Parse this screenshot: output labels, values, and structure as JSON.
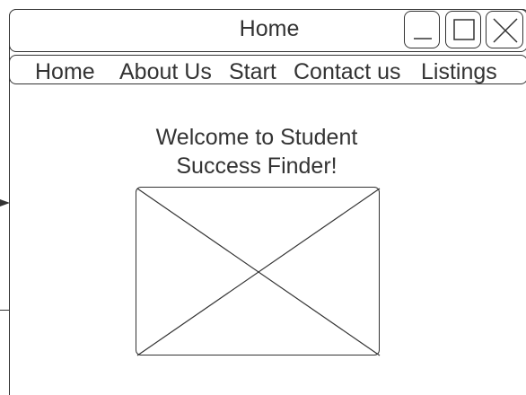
{
  "window": {
    "title": "Home"
  },
  "nav": {
    "items": [
      {
        "label": "Home"
      },
      {
        "label": "About Us"
      },
      {
        "label": "Start"
      },
      {
        "label": "Contact us"
      },
      {
        "label": "Listings"
      }
    ]
  },
  "main": {
    "welcome_line1": "Welcome to Student",
    "welcome_line2": "Success Finder!"
  },
  "icons": {
    "minimize": "minimize-icon",
    "maximize": "maximize-icon",
    "close": "close-icon",
    "image_placeholder": "image-placeholder-icon"
  },
  "colors": {
    "stroke": "#333333",
    "background": "#ffffff"
  }
}
